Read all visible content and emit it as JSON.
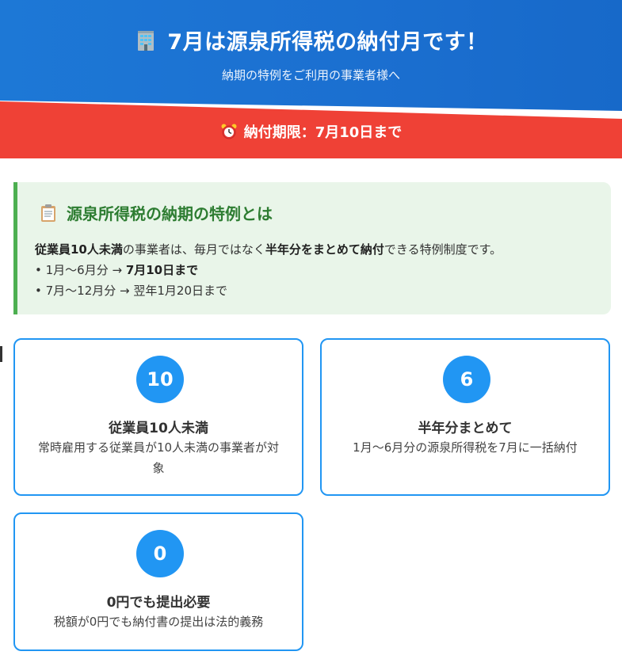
{
  "header": {
    "icon": "building-icon",
    "title": "7月は源泉所得税の納付月です！",
    "subtitle": "納期の特例をご利用の事業者様へ"
  },
  "deadline": {
    "icon": "alarm-clock-icon",
    "text": "納付期限：7月10日まで"
  },
  "info": {
    "icon": "clipboard-icon",
    "title": "源泉所得税の納期の特例とは",
    "line1_bold1": "従業員10人未満",
    "line1_mid": "の事業者は、毎月ではなく",
    "line1_bold2": "半年分をまとめて納付",
    "line1_end": "できる特例制度です。",
    "bullet1_prefix": "• 1月〜6月分 → ",
    "bullet1_bold": "7月10日まで",
    "bullet2": "• 7月〜12月分 → 翌年1月20日まで"
  },
  "cards": [
    {
      "number": "10",
      "title": "従業員10人未満",
      "description": "常時雇用する従業員が10人未満の事業者が対象"
    },
    {
      "number": "6",
      "title": "半年分まとめて",
      "description": "1月〜6月分の源泉所得税を7月に一括納付"
    },
    {
      "number": "0",
      "title": "0円でも提出必要",
      "description": "税額が0円でも納付書の提出は法的義務"
    }
  ],
  "colors": {
    "header_blue": "#1b6fd0",
    "deadline_red": "#ef4136",
    "info_green": "#4caf50",
    "card_blue": "#2196f3"
  }
}
